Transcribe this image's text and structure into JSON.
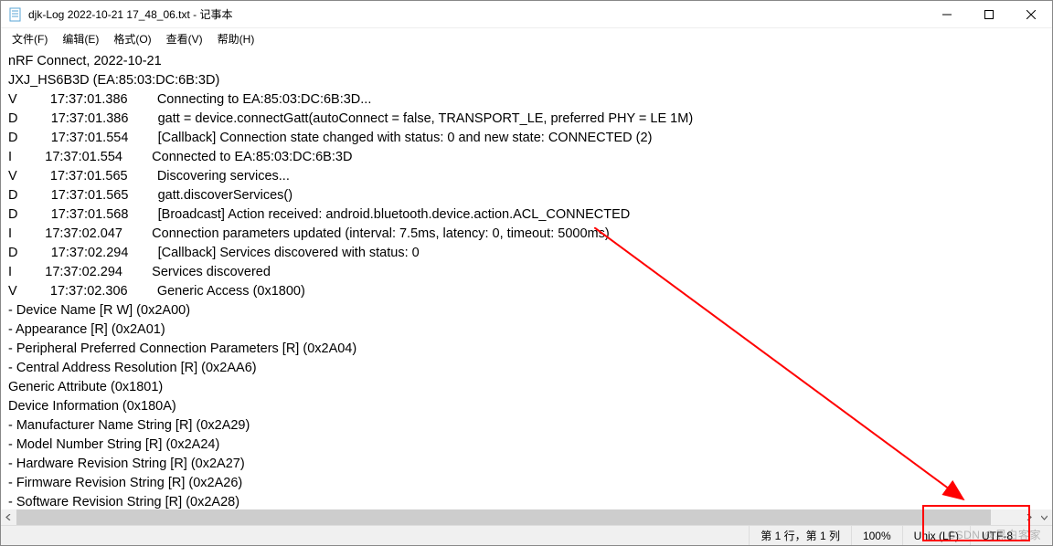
{
  "window": {
    "title": "djk-Log 2022-10-21 17_48_06.txt - 记事本"
  },
  "menu": {
    "file": "文件(F)",
    "edit": "编辑(E)",
    "format": "格式(O)",
    "view": "查看(V)",
    "help": "帮助(H)"
  },
  "content_lines": [
    "nRF Connect, 2022-10-21",
    "JXJ_HS6B3D (EA:85:03:DC:6B:3D)",
    "V\t17:37:01.386\tConnecting to EA:85:03:DC:6B:3D...",
    "D\t17:37:01.386\tgatt = device.connectGatt(autoConnect = false, TRANSPORT_LE, preferred PHY = LE 1M)",
    "D\t17:37:01.554\t[Callback] Connection state changed with status: 0 and new state: CONNECTED (2)",
    "I\t17:37:01.554\tConnected to EA:85:03:DC:6B:3D",
    "V\t17:37:01.565\tDiscovering services...",
    "D\t17:37:01.565\tgatt.discoverServices()",
    "D\t17:37:01.568\t[Broadcast] Action received: android.bluetooth.device.action.ACL_CONNECTED",
    "I\t17:37:02.047\tConnection parameters updated (interval: 7.5ms, latency: 0, timeout: 5000ms)",
    "D\t17:37:02.294\t[Callback] Services discovered with status: 0",
    "I\t17:37:02.294\tServices discovered",
    "V\t17:37:02.306\tGeneric Access (0x1800)",
    "- Device Name [R W] (0x2A00)",
    "- Appearance [R] (0x2A01)",
    "- Peripheral Preferred Connection Parameters [R] (0x2A04)",
    "- Central Address Resolution [R] (0x2AA6)",
    "Generic Attribute (0x1801)",
    "Device Information (0x180A)",
    "- Manufacturer Name String [R] (0x2A29)",
    "- Model Number String [R] (0x2A24)",
    "- Hardware Revision String [R] (0x2A27)",
    "- Firmware Revision String [R] (0x2A26)",
    "- Software Revision String [R] (0x2A28)"
  ],
  "statusbar": {
    "position": "第 1 行，第 1 列",
    "zoom": "100%",
    "eol": "Unix (LF)",
    "encoding": "UTF-8"
  },
  "watermark": "CSDN @黑白客家",
  "annotation": {
    "arrow_color": "#ff0000",
    "box_color": "#ff0000"
  }
}
